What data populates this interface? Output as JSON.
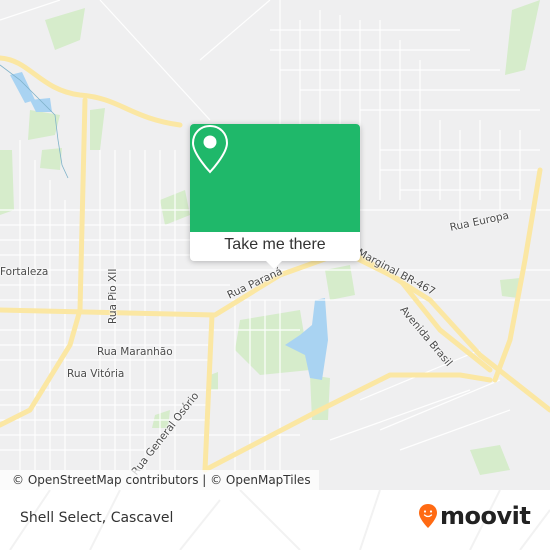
{
  "map": {
    "street_labels": [
      {
        "id": "fortaleza",
        "text": "Fortaleza"
      },
      {
        "id": "pio-xii",
        "text": "Rua Pio XII"
      },
      {
        "id": "maranhao",
        "text": "Rua Maranhão"
      },
      {
        "id": "vitoria",
        "text": "Rua Vitória"
      },
      {
        "id": "general-osorio",
        "text": "Rua General Osório"
      },
      {
        "id": "parana",
        "text": "Rua Paraná"
      },
      {
        "id": "marginal-br467",
        "text": "Marginal BR-467"
      },
      {
        "id": "europa",
        "text": "Rua Europa"
      },
      {
        "id": "avenida-brasil",
        "text": "Avenida Brasil"
      }
    ],
    "colors": {
      "background": "#efeff0",
      "major_road": "#fbe7a3",
      "minor_road": "#ffffff",
      "park": "#d6eccb",
      "water": "#a9d3f2"
    }
  },
  "popup": {
    "icon": "location-pin-icon",
    "button_label": "Take me there",
    "color": "#1fb86a"
  },
  "attribution": {
    "text": "© OpenStreetMap contributors | © OpenMapTiles"
  },
  "footer": {
    "place_name": "Shell Select, Cascavel",
    "brand": "moovit",
    "brand_color": "#ff6a13"
  }
}
